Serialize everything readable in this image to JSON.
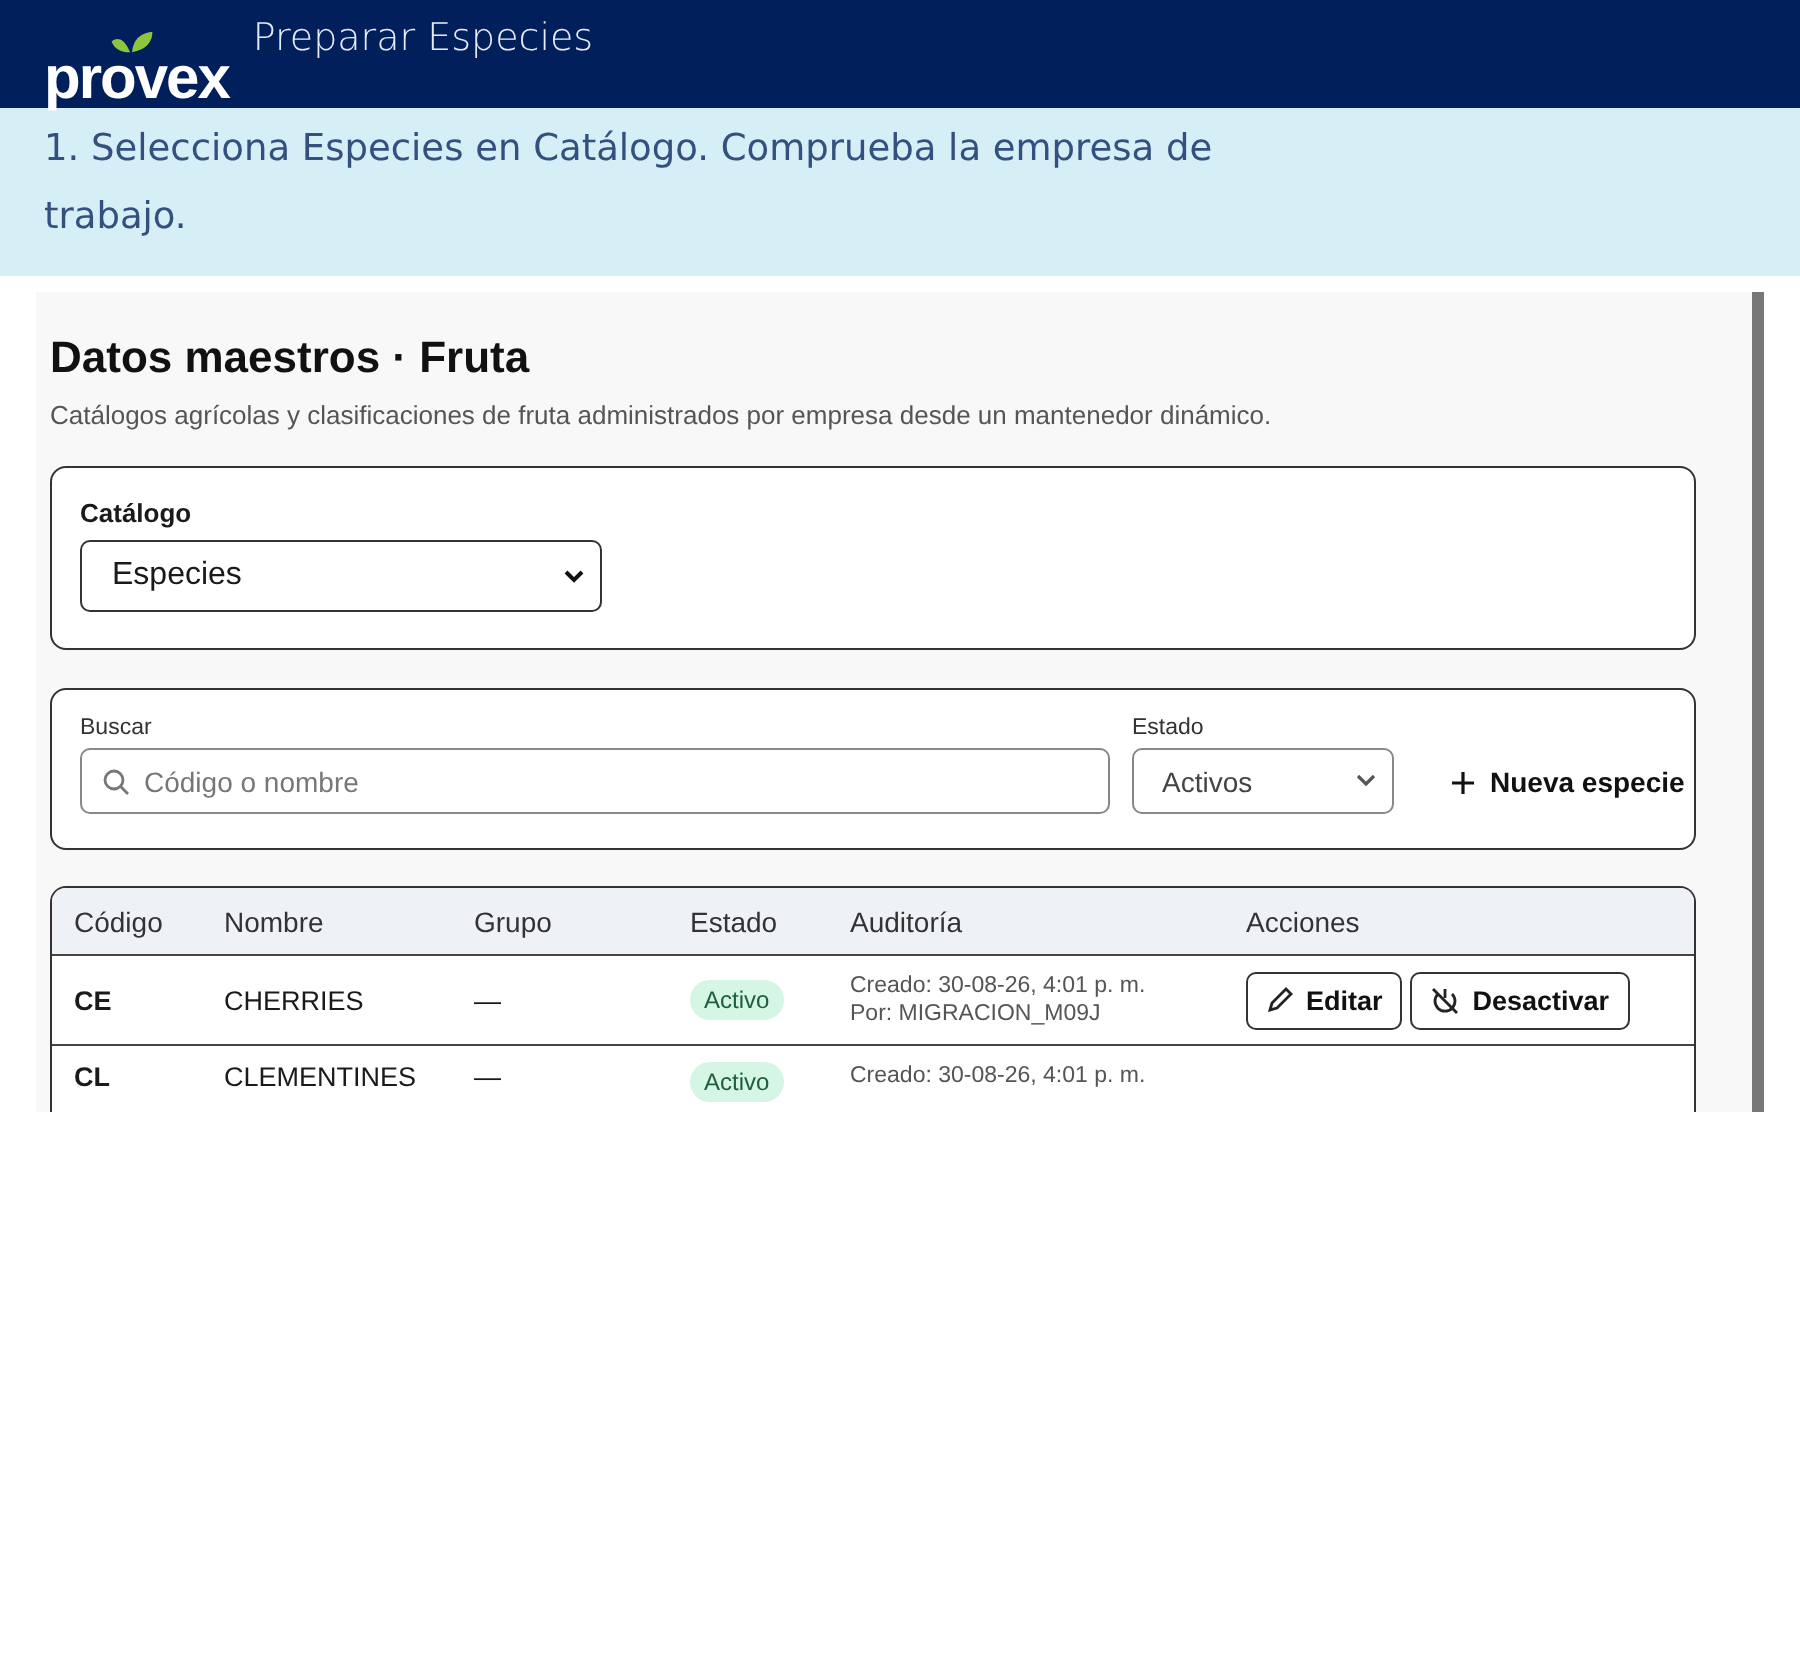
{
  "header": {
    "logo": "provex",
    "title": "Preparar Especies"
  },
  "instruction": "1. Selecciona Especies en Catálogo. Comprueba la empresa de trabajo.",
  "screenshot": {
    "title": "Datos maestros · Fruta",
    "subtitle": "Catálogos agrícolas y clasificaciones de fruta administrados por empresa desde un mantenedor dinámico.",
    "catalog": {
      "label": "Catálogo",
      "value": "Especies"
    },
    "filters": {
      "search_label": "Buscar",
      "search_placeholder": "Código o nombre",
      "state_label": "Estado",
      "state_value": "Activos",
      "new_button": "Nueva especie"
    },
    "table": {
      "columns": [
        "Código",
        "Nombre",
        "Grupo",
        "Estado",
        "Auditoría",
        "Acciones"
      ],
      "rows": [
        {
          "code": "CE",
          "name": "CHERRIES",
          "group": "—",
          "status": "Activo",
          "active": true,
          "created": "Creado: 30-08-26, 4:01 p. m.",
          "by": "Por: MIGRACION_M09J",
          "actions": [
            "Editar",
            "Desactivar"
          ]
        },
        {
          "code": "CL",
          "name": "CLEMENTINES",
          "group": "—",
          "status": "Activo",
          "active": true,
          "created": "Creado: 30-08-26, 4:01 p. m."
        }
      ]
    }
  }
}
